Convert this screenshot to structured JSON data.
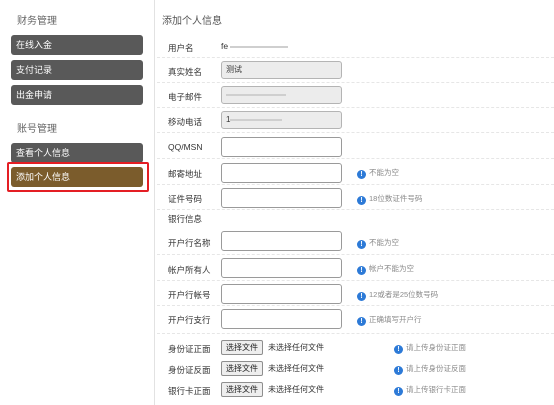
{
  "sidebar": {
    "finance_title": "财务管理",
    "finance_items": [
      "在线入金",
      "支付记录",
      "出金申请"
    ],
    "account_title": "账号管理",
    "account_items": [
      "查看个人信息",
      "添加个人信息"
    ]
  },
  "main": {
    "title": "添加个人信息",
    "username": {
      "label": "用户名",
      "value": "fe"
    },
    "realname": {
      "label": "真实姓名",
      "value": "测试"
    },
    "email": {
      "label": "电子邮件",
      "value": ""
    },
    "mobile": {
      "label": "移动电话",
      "value": "1"
    },
    "qq": {
      "label": "QQ/MSN",
      "value": ""
    },
    "address": {
      "label": "邮寄地址",
      "value": "",
      "hint": "不能为空"
    },
    "idnum": {
      "label": "证件号码",
      "value": "",
      "hint": "18位数证件号码"
    },
    "bank_section": "银行信息",
    "bank_name": {
      "label": "开户行名称",
      "value": "",
      "hint": "不能为空"
    },
    "account_holder": {
      "label": "帐户所有人",
      "value": "",
      "hint": "帐户不能为空"
    },
    "account_no": {
      "label": "开户行帐号",
      "value": "",
      "hint": "12或者是25位数号码"
    },
    "branch": {
      "label": "开户行支行",
      "value": "",
      "hint": "正确填写开户行"
    },
    "id_front": {
      "label": "身份证正面",
      "button": "选择文件",
      "status": "未选择任何文件",
      "hint": "请上传身份证正面"
    },
    "id_back": {
      "label": "身份证反面",
      "button": "选择文件",
      "status": "未选择任何文件",
      "hint": "请上传身份证反面"
    },
    "bankcard_front": {
      "label": "银行卡正面",
      "button": "选择文件",
      "status": "未选择任何文件",
      "hint": "请上传银行卡正面"
    }
  },
  "colors": {
    "menu": "#595959",
    "menu_active": "#7b5c2c",
    "highlight": "#e41e24",
    "info": "#2d7ad7"
  }
}
